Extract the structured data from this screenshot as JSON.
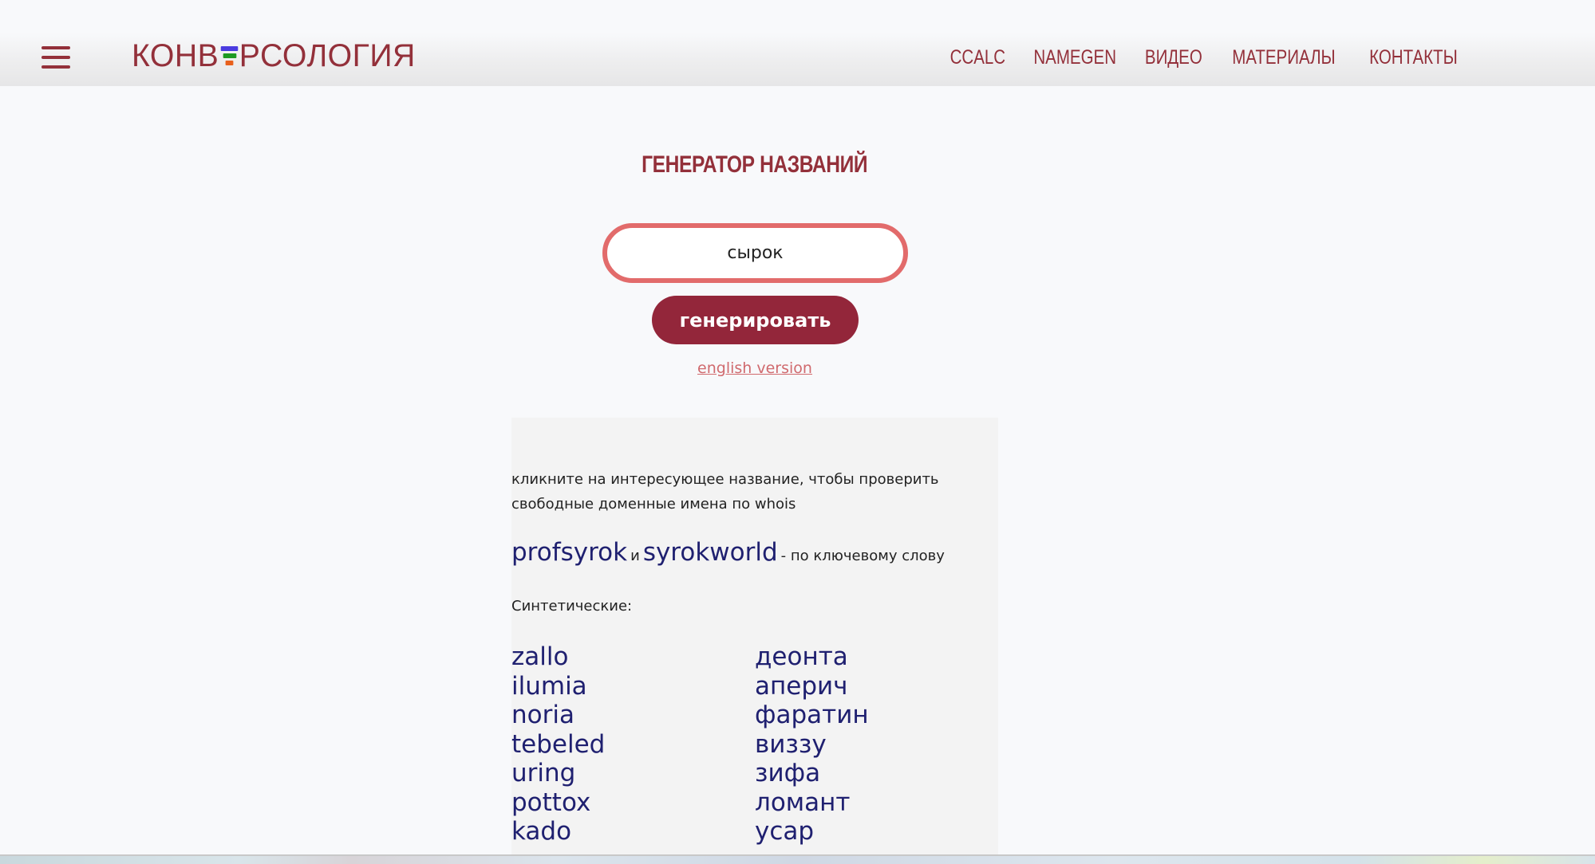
{
  "header": {
    "logo_text_before": "КОНВ",
    "logo_text_after": "РСОЛОГИЯ",
    "logo_mark_colors": [
      "#4a3be0",
      "#1e9a24",
      "#e8601c"
    ],
    "menu_icon": "hamburger-menu-icon",
    "nav": [
      {
        "label": "CCALC"
      },
      {
        "label": "NAMEGEN"
      },
      {
        "label": "ВИДЕО"
      },
      {
        "label": "МАТЕРИАЛЫ"
      },
      {
        "label": "КОНТАКТЫ"
      }
    ]
  },
  "main": {
    "title": "ГЕНЕРАТОР НАЗВАНИЙ",
    "search": {
      "value": "сырок",
      "placeholder": ""
    },
    "generate_label": "генерировать",
    "english_link": "english version"
  },
  "results": {
    "hint": "кликните на интересующее название, чтобы проверить свободные доменные имена по whois",
    "keyword": {
      "first": "profsyrok",
      "conjunction": "и",
      "second": "syrokworld",
      "suffix": "- по ключевому слову"
    },
    "synthetic_label": "Синтетические:",
    "left_column": [
      "zallo",
      "ilumia",
      "noria",
      "tebeled",
      "uring",
      "pottox",
      "kado"
    ],
    "right_column": [
      "деонта",
      "аперич",
      "фаратин",
      "виззу",
      "зифа",
      "ломант",
      "усар"
    ]
  },
  "colors": {
    "brand": "#93303a",
    "input_border": "#e26b6b",
    "button_bg": "#93263a",
    "link_names": "#1f2070",
    "english_link": "#d06a6e"
  }
}
